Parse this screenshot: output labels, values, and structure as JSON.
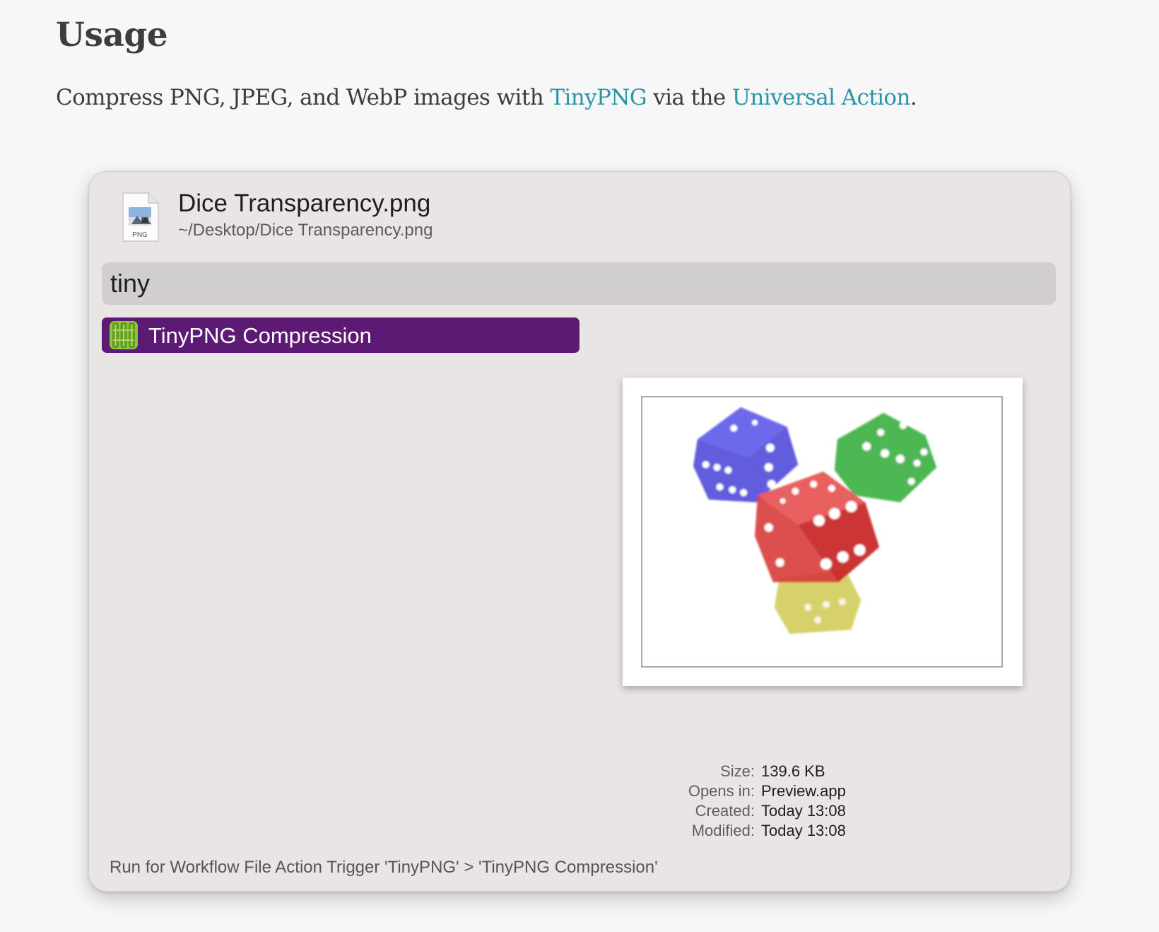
{
  "page": {
    "heading": "Usage",
    "intro": {
      "before": "Compress PNG, JPEG, and WebP images with ",
      "link1": "TinyPNG",
      "middle": " via the ",
      "link2": "Universal Action",
      "after": "."
    }
  },
  "alfred": {
    "file": {
      "name": "Dice Transparency.png",
      "path": "~/Desktop/Dice Transparency.png",
      "icon": "png-file-icon",
      "icon_label": "PNG"
    },
    "search": {
      "value": "tiny"
    },
    "results": [
      {
        "label": "TinyPNG Compression",
        "icon": "tinypng-workflow-icon",
        "selected": true
      }
    ],
    "metadata": [
      {
        "key": "Size:",
        "value": "139.6 KB"
      },
      {
        "key": "Opens in:",
        "value": "Preview.app"
      },
      {
        "key": "Created:",
        "value": "Today 13:08"
      },
      {
        "key": "Modified:",
        "value": "Today 13:08"
      }
    ],
    "footer": "Run for Workflow File Action Trigger 'TinyPNG' > 'TinyPNG Compression'"
  },
  "colors": {
    "accent_link": "#2a96a8",
    "selection": "#5c1a74",
    "window_bg": "#e8e5e4"
  }
}
